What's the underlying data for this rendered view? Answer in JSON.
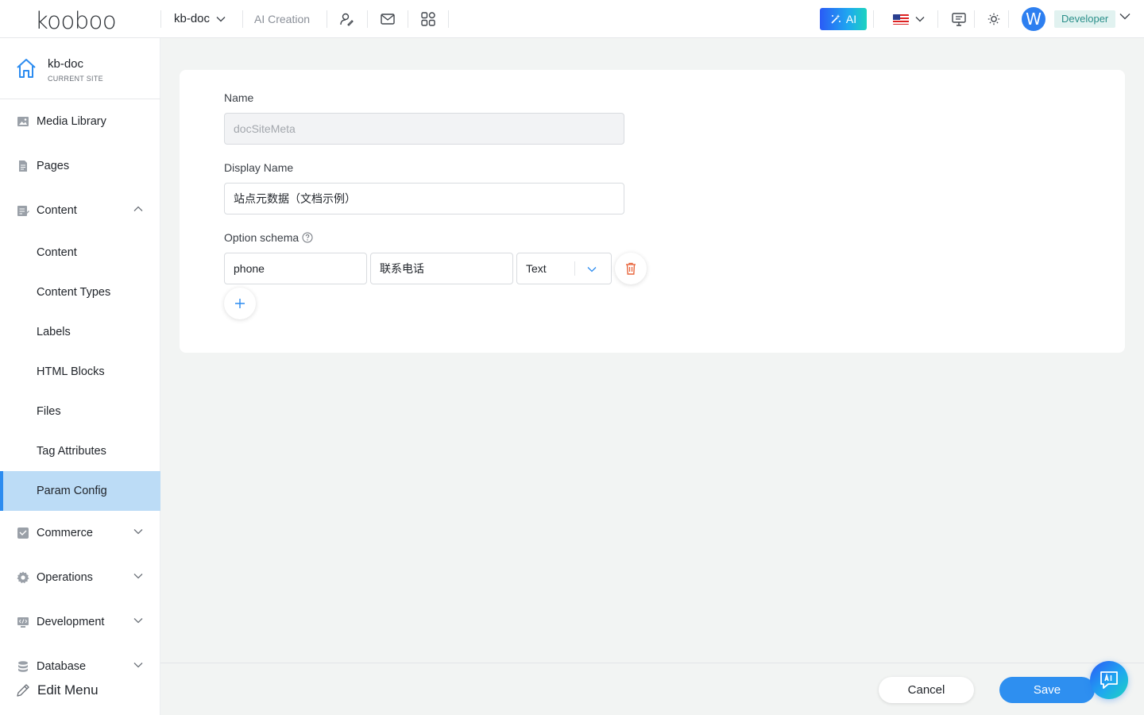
{
  "topbar": {
    "logo": "kooboo",
    "site_name": "kb-doc",
    "ai_creation": "AI Creation",
    "ai_button": "AI",
    "avatar_letter": "W",
    "role": "Developer"
  },
  "sidebar": {
    "site_name": "kb-doc",
    "site_sub": "CURRENT SITE",
    "items": [
      {
        "label": "Media Library",
        "icon": "image-icon"
      },
      {
        "label": "Pages",
        "icon": "page-icon"
      },
      {
        "label": "Content",
        "icon": "content-icon",
        "expanded": true
      }
    ],
    "content_sub": [
      {
        "label": "Content"
      },
      {
        "label": "Content Types"
      },
      {
        "label": "Labels"
      },
      {
        "label": "HTML Blocks"
      },
      {
        "label": "Files"
      },
      {
        "label": "Tag Attributes"
      },
      {
        "label": "Param Config",
        "active": true
      }
    ],
    "more_items": [
      {
        "label": "Commerce",
        "icon": "commerce-icon"
      },
      {
        "label": "Operations",
        "icon": "gear-icon"
      },
      {
        "label": "Development",
        "icon": "code-icon"
      },
      {
        "label": "Database",
        "icon": "database-icon"
      }
    ],
    "edit_menu": "Edit Menu"
  },
  "form": {
    "name_label": "Name",
    "name_value": "docSiteMeta",
    "display_name_label": "Display Name",
    "display_name_value": "站点元数据（文档示例）",
    "option_schema_label": "Option schema",
    "schema_rows": [
      {
        "key": "phone",
        "display": "联系电话",
        "type": "Text"
      }
    ]
  },
  "footer": {
    "cancel": "Cancel",
    "save": "Save"
  },
  "colors": {
    "accent": "#2e8ff0",
    "active_bg": "#bcdcf6",
    "delete": "#e8663d"
  }
}
